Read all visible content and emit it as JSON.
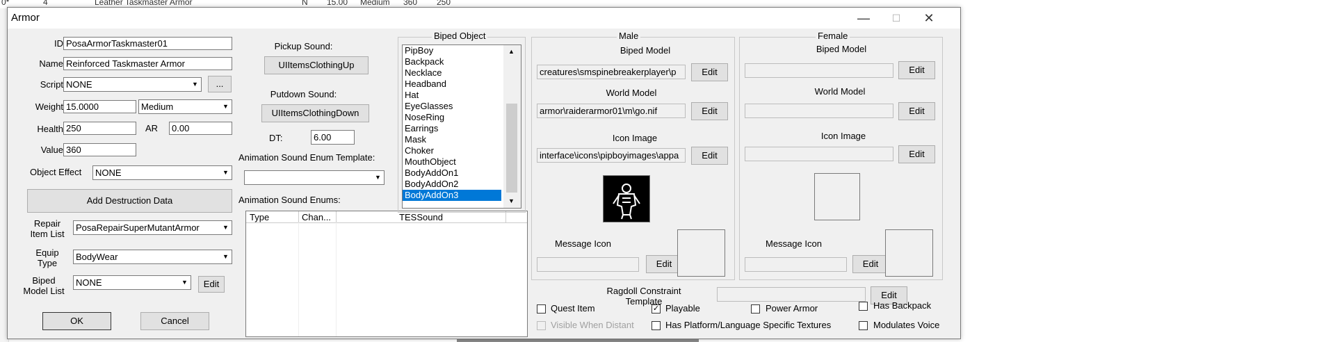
{
  "background_row": {
    "cells": [
      "0*",
      "4",
      "Leather Taskmaster Armor",
      "N",
      "15.00",
      "Medium",
      "360",
      "250"
    ]
  },
  "window": {
    "title": "Armor",
    "minimize": "—",
    "maximize": "☐",
    "close": "✕"
  },
  "fields": {
    "id_label": "ID",
    "id_value": "PosaArmorTaskmaster01",
    "name_label": "Name",
    "name_value": "Reinforced Taskmaster Armor",
    "script_label": "Script",
    "script_value": "NONE",
    "script_browse": "...",
    "weight_label": "Weight",
    "weight_value": "15.0000",
    "weight_class": "Medium",
    "health_label": "Health",
    "health_value": "250",
    "ar_label": "AR",
    "ar_value": "0.00",
    "value_label": "Value",
    "value_value": "360",
    "object_effect_label": "Object Effect",
    "object_effect_value": "NONE",
    "add_destruction": "Add Destruction Data",
    "repair_label_1": "Repair",
    "repair_label_2": "Item List",
    "repair_value": "PosaRepairSuperMutantArmor",
    "equip_label_1": "Equip",
    "equip_label_2": "Type",
    "equip_value": "BodyWear",
    "biped_list_label_1": "Biped",
    "biped_list_label_2": "Model List",
    "biped_list_value": "NONE",
    "biped_list_edit": "Edit",
    "ok": "OK",
    "cancel": "Cancel"
  },
  "sounds": {
    "pickup_label": "Pickup Sound:",
    "pickup_value": "UIItemsClothingUp",
    "putdown_label": "Putdown Sound:",
    "putdown_value": "UIItemsClothingDown",
    "dt_label": "DT:",
    "dt_value": "6.00",
    "anim_template_label": "Animation Sound Enum Template:",
    "anim_template_value": "",
    "anim_enums_label": "Animation Sound Enums:",
    "table_headers": [
      "Type",
      "Chan...",
      "TESSound"
    ]
  },
  "biped_object": {
    "title": "Biped Object",
    "items": [
      "PipBoy",
      "Backpack",
      "Necklace",
      "Headband",
      "Hat",
      "EyeGlasses",
      "NoseRing",
      "Earrings",
      "Mask",
      "Choker",
      "MouthObject",
      "BodyAddOn1",
      "BodyAddOn2",
      "BodyAddOn3"
    ],
    "selected": "BodyAddOn3"
  },
  "male": {
    "title": "Male",
    "biped_model_label": "Biped Model",
    "biped_model_value": "creatures\\smspinebreakerplayer\\p",
    "world_model_label": "World Model",
    "world_model_value": "armor\\raiderarmor01\\m\\go.nif",
    "icon_image_label": "Icon Image",
    "icon_image_value": "interface\\icons\\pipboyimages\\appa",
    "message_icon_label": "Message Icon",
    "message_icon_value": "",
    "edit": "Edit"
  },
  "female": {
    "title": "Female",
    "biped_model_label": "Biped Model",
    "world_model_label": "World Model",
    "icon_image_label": "Icon Image",
    "message_icon_label": "Message Icon",
    "edit": "Edit"
  },
  "ragdoll": {
    "label_1": "Ragdoll Constraint",
    "label_2": "Template",
    "value": "",
    "edit": "Edit"
  },
  "flags": {
    "quest_item": "Quest Item",
    "playable": "Playable",
    "power_armor": "Power Armor",
    "has_backpack": "Has Backpack",
    "visible_when_distant": "Visible When Distant",
    "platform_textures": "Has Platform/Language Specific Textures",
    "modulates_voice": "Modulates Voice",
    "playable_checked": "✓"
  }
}
